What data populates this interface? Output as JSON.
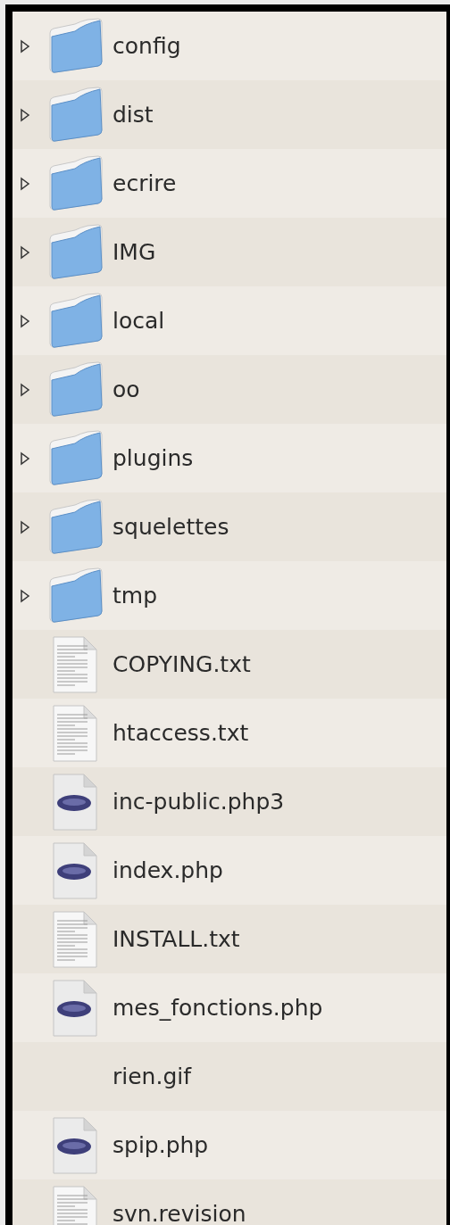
{
  "files": [
    {
      "name": "config",
      "kind": "folder",
      "expanded": false
    },
    {
      "name": "dist",
      "kind": "folder",
      "expanded": false
    },
    {
      "name": "ecrire",
      "kind": "folder",
      "expanded": false
    },
    {
      "name": "IMG",
      "kind": "folder",
      "expanded": false
    },
    {
      "name": "local",
      "kind": "folder",
      "expanded": false
    },
    {
      "name": "oo",
      "kind": "folder",
      "expanded": false
    },
    {
      "name": "plugins",
      "kind": "folder",
      "expanded": false
    },
    {
      "name": "squelettes",
      "kind": "folder",
      "expanded": false
    },
    {
      "name": "tmp",
      "kind": "folder",
      "expanded": false
    },
    {
      "name": "COPYING.txt",
      "kind": "text"
    },
    {
      "name": "htaccess.txt",
      "kind": "text"
    },
    {
      "name": "inc-public.php3",
      "kind": "php"
    },
    {
      "name": "index.php",
      "kind": "php"
    },
    {
      "name": "INSTALL.txt",
      "kind": "text"
    },
    {
      "name": "mes_fonctions.php",
      "kind": "php"
    },
    {
      "name": "rien.gif",
      "kind": "blank"
    },
    {
      "name": "spip.php",
      "kind": "php"
    },
    {
      "name": "svn.revision",
      "kind": "text"
    }
  ]
}
